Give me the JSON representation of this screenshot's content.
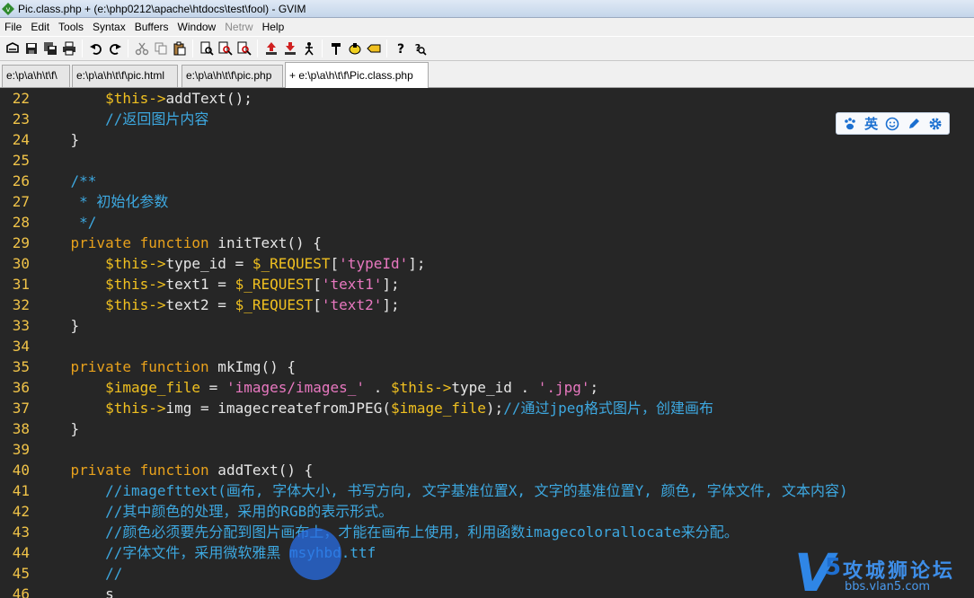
{
  "window": {
    "title": "Pic.class.php + (e:\\php0212\\apache\\htdocs\\test\\fool) - GVIM"
  },
  "menu": [
    {
      "label": "File",
      "disabled": false
    },
    {
      "label": "Edit",
      "disabled": false
    },
    {
      "label": "Tools",
      "disabled": false
    },
    {
      "label": "Syntax",
      "disabled": false
    },
    {
      "label": "Buffers",
      "disabled": false
    },
    {
      "label": "Window",
      "disabled": false
    },
    {
      "label": "Netrw",
      "disabled": true
    },
    {
      "label": "Help",
      "disabled": false
    }
  ],
  "toolbar": {
    "icons": [
      "open-icon",
      "save-icon",
      "save-all-icon",
      "print-icon",
      "undo-icon",
      "redo-icon",
      "cut-icon",
      "copy-icon",
      "paste-icon",
      "find-replace-icon",
      "find-next-icon",
      "find-prev-icon",
      "load-session-icon",
      "save-session-icon",
      "run-script-icon",
      "make-icon",
      "shell-icon",
      "tags-icon",
      "help-icon",
      "find-help-icon"
    ]
  },
  "tabs": [
    {
      "label": "e:\\p\\a\\h\\t\\f\\",
      "active": false
    },
    {
      "label": "e:\\p\\a\\h\\t\\f\\pic.html",
      "active": false
    },
    {
      "label": "e:\\p\\a\\h\\t\\f\\pic.php",
      "active": false
    },
    {
      "label": "+ e:\\p\\a\\h\\t\\f\\Pic.class.php",
      "active": true
    }
  ],
  "code": {
    "lines": [
      {
        "n": "22",
        "text": "        $this->addText();"
      },
      {
        "n": "23",
        "text": "        //返回图片内容"
      },
      {
        "n": "24",
        "text": "    }"
      },
      {
        "n": "25",
        "text": ""
      },
      {
        "n": "26",
        "text": "    /**"
      },
      {
        "n": "27",
        "text": "     * 初始化参数"
      },
      {
        "n": "28",
        "text": "     */"
      },
      {
        "n": "29",
        "text": "    private function initText() {"
      },
      {
        "n": "30",
        "text": "        $this->type_id = $_REQUEST['typeId'];"
      },
      {
        "n": "31",
        "text": "        $this->text1 = $_REQUEST['text1'];"
      },
      {
        "n": "32",
        "text": "        $this->text2 = $_REQUEST['text2'];"
      },
      {
        "n": "33",
        "text": "    }"
      },
      {
        "n": "34",
        "text": ""
      },
      {
        "n": "35",
        "text": "    private function mkImg() {"
      },
      {
        "n": "36",
        "text": "        $image_file = 'images/images_' . $this->type_id . '.jpg';"
      },
      {
        "n": "37",
        "text": "        $this->img = imagecreatefromJPEG($image_file);//通过jpeg格式图片，创建画布"
      },
      {
        "n": "38",
        "text": "    }"
      },
      {
        "n": "39",
        "text": ""
      },
      {
        "n": "40",
        "text": "    private function addText() {"
      },
      {
        "n": "41",
        "text": "        //imagefttext(画布, 字体大小, 书写方向, 文字基准位置X, 文字的基准位置Y, 颜色, 字体文件, 文本内容)"
      },
      {
        "n": "42",
        "text": "        //其中颜色的处理，采用的RGB的表示形式。"
      },
      {
        "n": "43",
        "text": "        //颜色必须要先分配到图片画布上，才能在画布上使用，利用函数imagecolorallocate来分配。"
      },
      {
        "n": "44",
        "text": "        //字体文件，采用微软雅黑 msyhbd.ttf"
      },
      {
        "n": "45",
        "text": "        //"
      },
      {
        "n": "46",
        "text": "        s"
      }
    ]
  },
  "ime_toolbar": {
    "items": [
      {
        "icon": "paw-icon",
        "label": ""
      },
      {
        "icon": "english-mode-icon",
        "label": "英"
      },
      {
        "icon": "smiley-icon",
        "label": ""
      },
      {
        "icon": "pen-icon",
        "label": ""
      },
      {
        "icon": "settings-gear-icon",
        "label": ""
      }
    ]
  },
  "watermark": {
    "brand": "攻城狮论坛",
    "url": "bbs.vlan5.com",
    "logo_text": "V5"
  },
  "colors": {
    "editor_bg": "#262626",
    "line_number": "#f0c348",
    "keyword": "#e8a11c",
    "variable": "#f0c020",
    "string": "#e878c0",
    "comment": "#3da8e0",
    "text": "#e6e6e6"
  }
}
